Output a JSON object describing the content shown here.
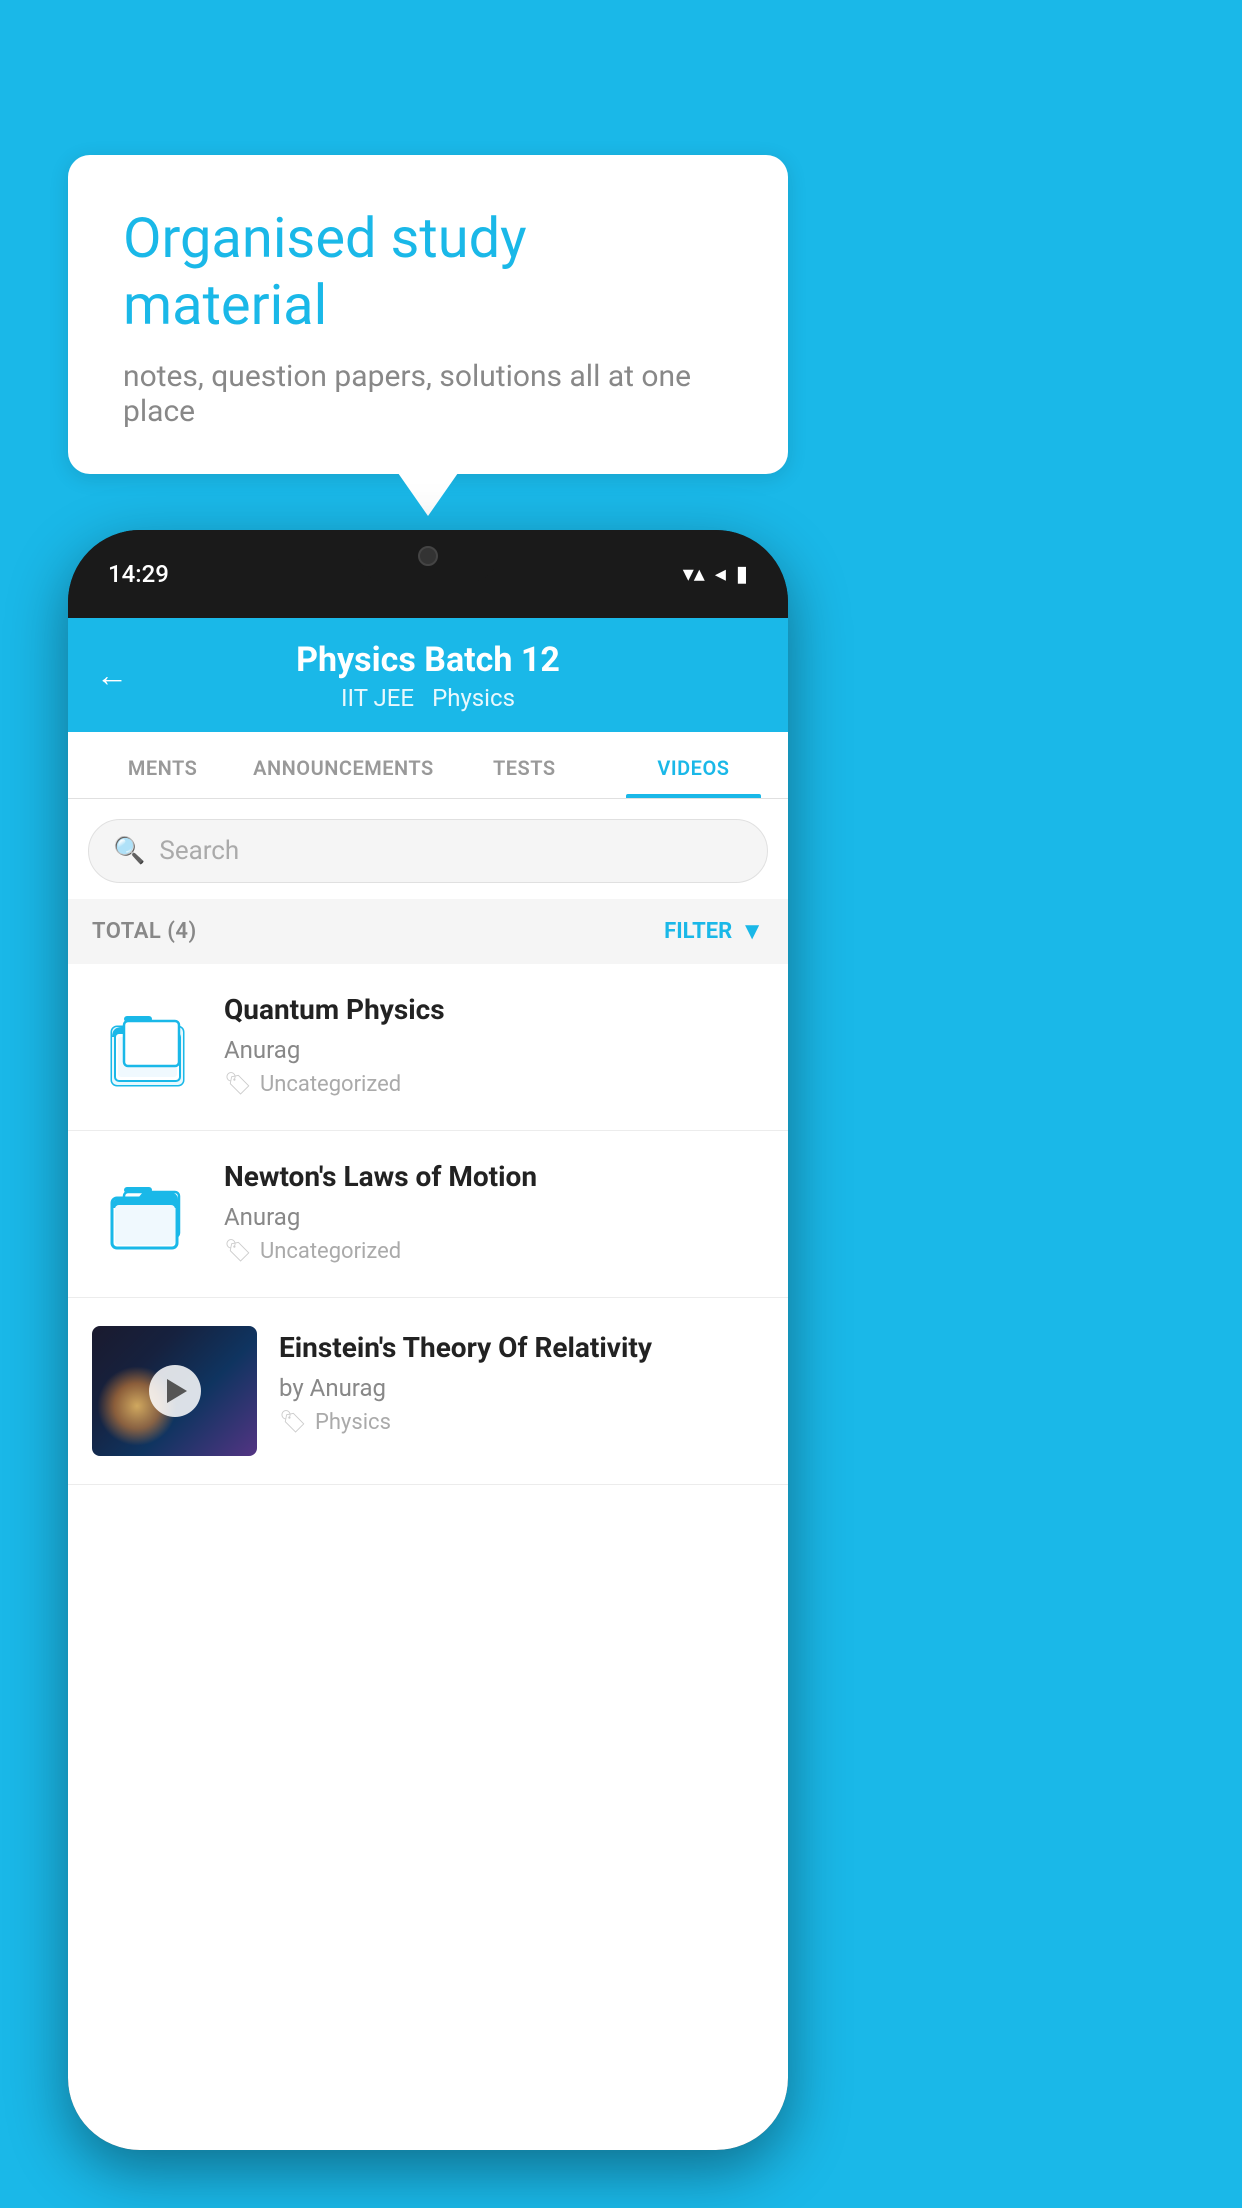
{
  "background_color": "#1ab8e8",
  "speech_bubble": {
    "title": "Organised study material",
    "subtitle": "notes, question papers, solutions all at one place"
  },
  "phone": {
    "status_bar": {
      "time": "14:29",
      "wifi": "▼▲",
      "signal": "◀",
      "battery": "▮"
    },
    "header": {
      "back_label": "←",
      "title": "Physics Batch 12",
      "subtitle_1": "IIT JEE",
      "subtitle_2": "Physics"
    },
    "tabs": [
      {
        "label": "MENTS",
        "active": false
      },
      {
        "label": "ANNOUNCEMENTS",
        "active": false
      },
      {
        "label": "TESTS",
        "active": false
      },
      {
        "label": "VIDEOS",
        "active": true
      }
    ],
    "search": {
      "placeholder": "Search"
    },
    "filter_bar": {
      "total_label": "TOTAL (4)",
      "filter_label": "FILTER"
    },
    "videos": [
      {
        "id": 1,
        "title": "Quantum Physics",
        "author": "Anurag",
        "tag": "Uncategorized",
        "type": "folder"
      },
      {
        "id": 2,
        "title": "Newton's Laws of Motion",
        "author": "Anurag",
        "tag": "Uncategorized",
        "type": "folder"
      },
      {
        "id": 3,
        "title": "Einstein's Theory Of Relativity",
        "author_prefix": "by",
        "author": "Anurag",
        "tag": "Physics",
        "type": "video"
      }
    ]
  }
}
